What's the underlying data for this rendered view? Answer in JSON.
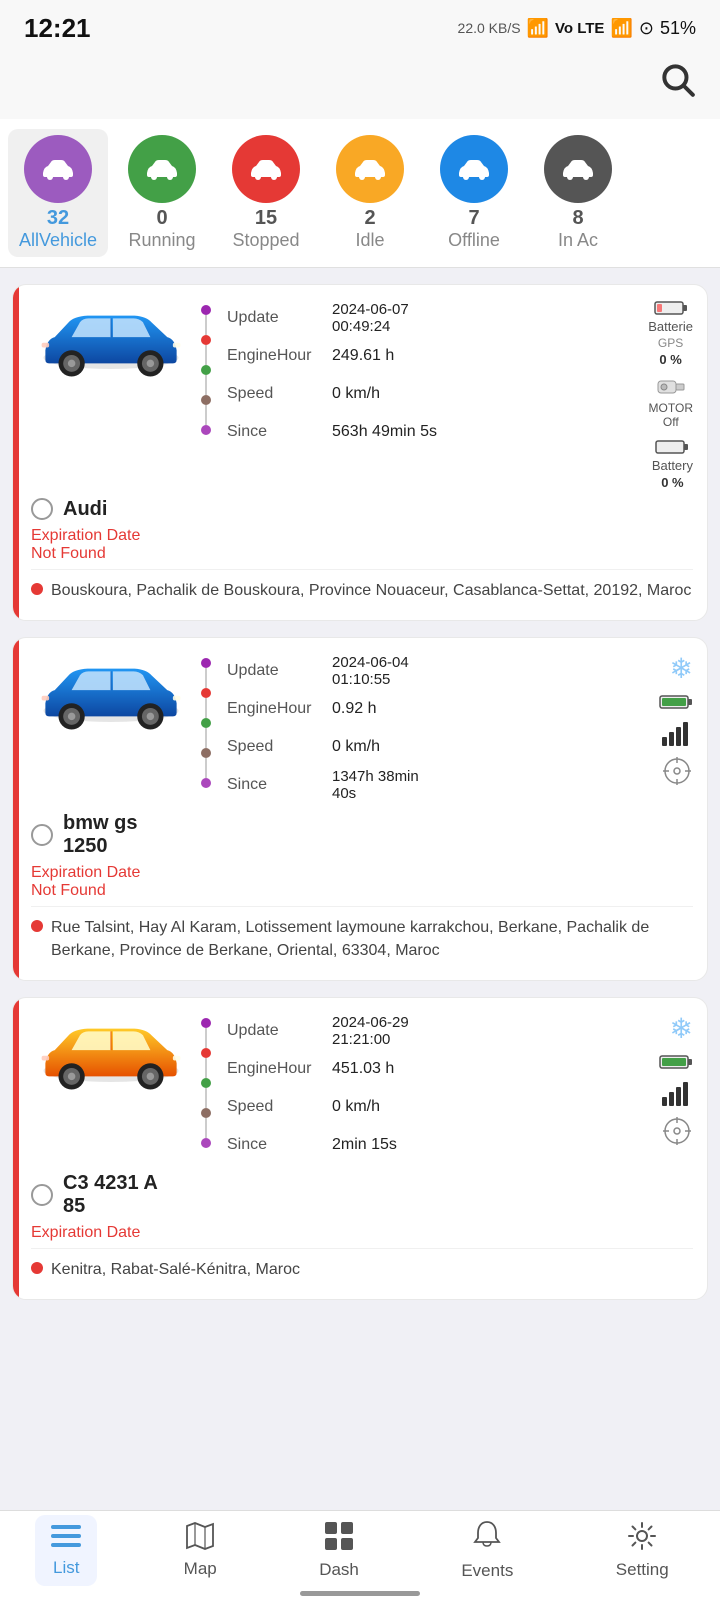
{
  "statusBar": {
    "time": "12:21",
    "network": "22.0 KB/S",
    "battery": "51%"
  },
  "tabs": [
    {
      "id": "all",
      "count": "32",
      "label": "AllVehicle",
      "color": "#9c5bbf",
      "active": true
    },
    {
      "id": "running",
      "count": "0",
      "label": "Running",
      "color": "#43a047",
      "active": false
    },
    {
      "id": "stopped",
      "count": "15",
      "label": "Stopped",
      "color": "#e53935",
      "active": false
    },
    {
      "id": "idle",
      "count": "2",
      "label": "Idle",
      "color": "#f9a825",
      "active": false
    },
    {
      "id": "offline",
      "count": "7",
      "label": "Offline",
      "color": "#1e88e5",
      "active": false
    },
    {
      "id": "inac",
      "count": "8",
      "label": "In Ac",
      "color": "#555",
      "active": false
    }
  ],
  "vehicles": [
    {
      "name": "Audi",
      "carColor": "#1565c0",
      "updateDate": "2024-06-07",
      "updateTime": "00:49:24",
      "engineHour": "249.61 h",
      "speed": "0 km/h",
      "since": "563h 49min 5s",
      "expiryText": "Expiration Date\nNot Found",
      "batterie": "Batterie",
      "batterieGPS": "GPS",
      "batterieGPSValue": "0 %",
      "motorStatus": "MOTOR\nOff",
      "batteryLabel": "Battery",
      "batteryValue": "0 %",
      "address": "Bouskoura, Pachalik de Bouskoura, Province Nouaceur, Casablanca-Settat, 20192, Maroc"
    },
    {
      "name": "bmw gs\n1250",
      "carColor": "#1565c0",
      "updateDate": "2024-06-04",
      "updateTime": "01:10:55",
      "engineHour": "0.92 h",
      "speed": "0 km/h",
      "since": "1347h 38min\n40s",
      "expiryText": "Expiration Date\nNot Found",
      "snowflake": "❄",
      "batteryFull": true,
      "signalFull": true,
      "crosshair": true,
      "address": "Rue Talsint, Hay Al Karam, Lotissement laymoune karrakchou, Berkane, Pachalik de Berkane, Province de Berkane, Oriental, 63304, Maroc"
    },
    {
      "name": "C3 4231 A\n85",
      "carColor": "#f9a825",
      "updateDate": "2024-06-29",
      "updateTime": "21:21:00",
      "engineHour": "451.03 h",
      "speed": "0 km/h",
      "since": "2min 15s",
      "expiryText": "Expiration Date",
      "snowflake": "❄",
      "batteryFull": true,
      "signalFull": true,
      "crosshair": true,
      "address": "Kenitra, Rabat-Salé-Kénitra, Maroc"
    }
  ],
  "bottomNav": {
    "items": [
      {
        "id": "list",
        "label": "List",
        "icon": "≡",
        "active": true
      },
      {
        "id": "map",
        "label": "Map",
        "icon": "🗺",
        "active": false
      },
      {
        "id": "dash",
        "label": "Dash",
        "icon": "⊞",
        "active": false
      },
      {
        "id": "events",
        "label": "Events",
        "icon": "🔔",
        "active": false
      },
      {
        "id": "setting",
        "label": "Setting",
        "icon": "⚙",
        "active": false
      }
    ]
  }
}
